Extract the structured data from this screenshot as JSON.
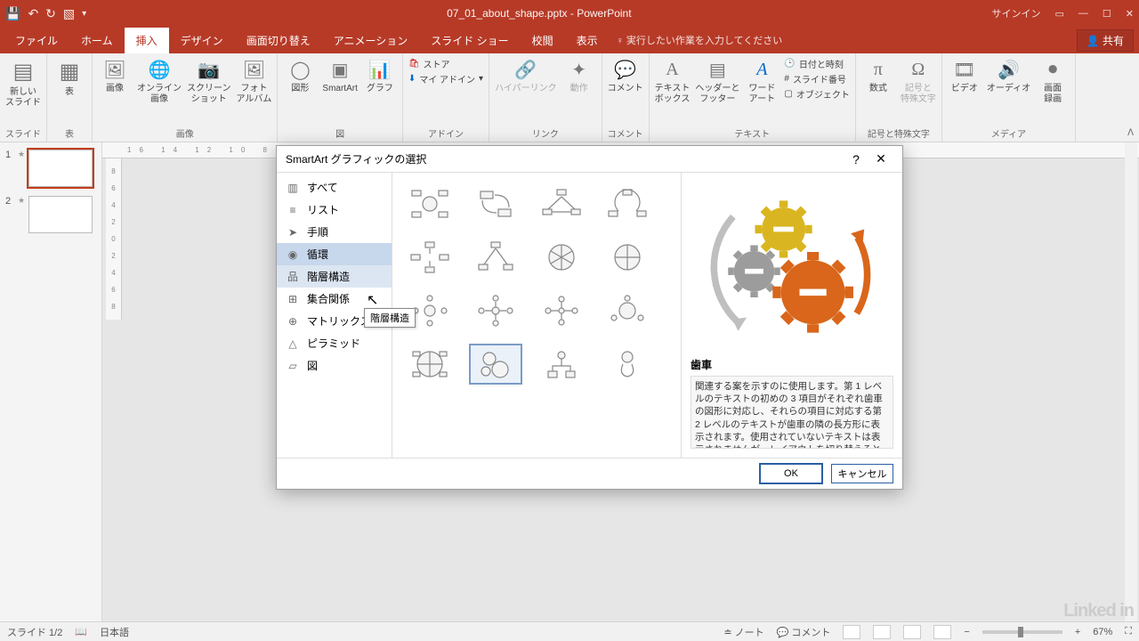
{
  "titlebar": {
    "filename": "07_01_about_shape.pptx - PowerPoint",
    "signin": "サインイン"
  },
  "tabs": {
    "file": "ファイル",
    "home": "ホーム",
    "insert": "挿入",
    "design": "デザイン",
    "transition": "画面切り替え",
    "animation": "アニメーション",
    "slideshow": "スライド ショー",
    "review": "校閲",
    "view": "表示",
    "tellme": "実行したい作業を入力してください",
    "share": "共有"
  },
  "ribbon": {
    "newslide": "新しい\nスライド",
    "newslide_grp": "スライド",
    "table": "表",
    "table_grp": "表",
    "image": "画像",
    "online_img": "オンライン\n画像",
    "screenshot": "スクリーン\nショット",
    "photo_album": "フォト\nアルバム",
    "image_grp": "画像",
    "shapes": "図形",
    "smartart": "SmartArt",
    "chart": "グラフ",
    "zu_grp": "図",
    "store": "ストア",
    "myaddins": "マイ アドイン",
    "addin_grp": "アドイン",
    "hyperlink": "ハイパーリンク",
    "action": "動作",
    "link_grp": "リンク",
    "comment": "コメント",
    "comment_grp": "コメント",
    "textbox": "テキスト\nボックス",
    "headerfooter": "ヘッダーと\nフッター",
    "wordart": "ワード\nアート",
    "datetime": "日付と時刻",
    "slidenum": "スライド番号",
    "object": "オブジェクト",
    "text_grp": "テキスト",
    "equation": "数式",
    "symbol": "記号と\n特殊文字",
    "symbol_grp": "記号と特殊文字",
    "video": "ビデオ",
    "audio": "オーディオ",
    "screenrec": "画面\n録画",
    "media_grp": "メディア"
  },
  "thumbs": {
    "n1": "1",
    "n2": "2"
  },
  "status": {
    "slide": "スライド 1/2",
    "lang": "日本語",
    "notes": "ノート",
    "comments": "コメント",
    "zoom": "67%"
  },
  "dialog": {
    "title": "SmartArt グラフィックの選択",
    "help": "?",
    "close": "✕",
    "cats": {
      "all": "すべて",
      "list": "リスト",
      "process": "手順",
      "cycle": "循環",
      "hierarchy": "階層構造",
      "relationship": "集合関係",
      "matrix": "マトリックス",
      "pyramid": "ピラミッド",
      "picture": "図"
    },
    "tooltip": "階層構造",
    "preview_title": "歯車",
    "preview_desc": "関連する案を示すのに使用します。第 1 レベルのテキストの初めの 3 項目がそれぞれ歯車の図形に対応し、それらの項目に対応する第 2 レベルのテキストが歯車の隣の長方形に表示されます。使用されていないテキストは表示されませんが、レイアウトを切り替えると",
    "ok": "OK",
    "cancel": "キャンセル"
  },
  "watermark": "Linked in"
}
